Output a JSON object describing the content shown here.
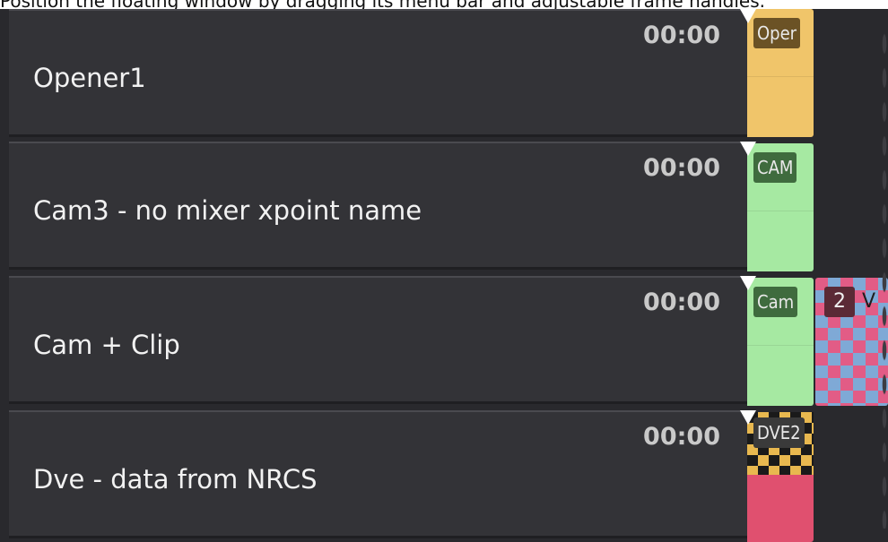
{
  "caption": "Position the floating window by dragging its menu bar and adjustable frame handles.",
  "rows": [
    {
      "name": "Opener1",
      "time": "00:00",
      "tag": "Oper",
      "color": "#f0c56a",
      "tag_bg": "#6b5225"
    },
    {
      "name": "Cam3 - no mixer xpoint name",
      "time": "00:00",
      "tag": "CAM",
      "color": "#a6e9a2",
      "tag_bg": "#3f6b3e"
    },
    {
      "name": "Cam + Clip",
      "time": "00:00",
      "tag": "Cam",
      "color": "#a6e9a2",
      "tag_bg": "#3f6b3e",
      "extra_clip": {
        "number": "2",
        "label": "V"
      }
    },
    {
      "name": "Dve - data from NRCS",
      "time": "00:00",
      "tag": "DVE2",
      "color": "#e0506f",
      "tag_bg": "#3a3a3a"
    }
  ]
}
